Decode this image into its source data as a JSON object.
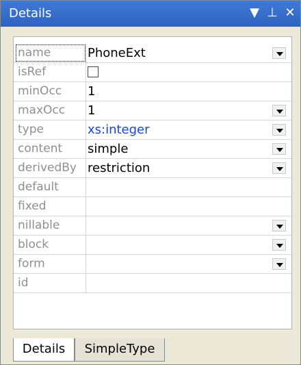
{
  "title": "Details",
  "title_icons": {
    "dropdown": "▼",
    "pin": "⊥",
    "close": "✕"
  },
  "properties": [
    {
      "label": "name",
      "value": "PhoneExt",
      "dropdown": true
    },
    {
      "label": "isRef",
      "value": "",
      "checkbox": true
    },
    {
      "label": "minOcc",
      "value": "1"
    },
    {
      "label": "maxOcc",
      "value": "1",
      "dropdown": true
    },
    {
      "label": "type",
      "value": "xs:integer",
      "dropdown": true,
      "link": true
    },
    {
      "label": "content",
      "value": "simple",
      "dropdown": true
    },
    {
      "label": "derivedBy",
      "value": "restriction",
      "dropdown": true
    },
    {
      "label": "default",
      "value": ""
    },
    {
      "label": "fixed",
      "value": ""
    },
    {
      "label": "nillable",
      "value": "",
      "dropdown": true
    },
    {
      "label": "block",
      "value": "",
      "dropdown": true
    },
    {
      "label": "form",
      "value": "",
      "dropdown": true
    },
    {
      "label": "id",
      "value": ""
    }
  ],
  "tabs": [
    {
      "label": "Details",
      "active": true
    },
    {
      "label": "SimpleType",
      "active": false
    }
  ]
}
